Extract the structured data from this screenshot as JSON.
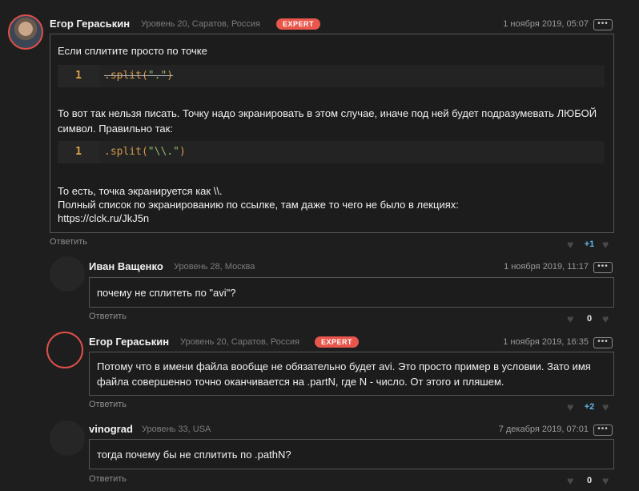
{
  "comments": [
    {
      "author": "Егор Гераськин",
      "meta": "Уровень 20, Саратов, Россия",
      "badge": "EXPERT",
      "date": "1 ноября 2019, 05:07",
      "text1": "Если сплитите просто по точке",
      "code1": {
        "line": "1",
        "prefix": ".split(",
        "str": "\".\"",
        "suffix": ")"
      },
      "text2": "То вот так нельзя писать. Точку надо экранировать в этом случае, иначе под ней будет подразумевать ЛЮБОЙ символ. Правильно так:",
      "code2": {
        "line": "1",
        "prefix": ".split(",
        "str": "\"\\\\.\"",
        "suffix": ")"
      },
      "text3a": "То есть, точка экранируется как \\\\.",
      "text3b": "Полный список по экранированию по ссылке, там даже то чего не было в лекциях:",
      "text3c": "https://clck.ru/JkJ5n",
      "reply": "Ответить",
      "votes": "+1"
    },
    {
      "author": "Иван Ващенко",
      "meta": "Уровень 28, Москва",
      "date": "1 ноября 2019, 11:17",
      "text": "почему не сплитеть по \"avi\"?",
      "reply": "Ответить",
      "votes": "0"
    },
    {
      "author": "Егор Гераськин",
      "meta": "Уровень 20, Саратов, Россия",
      "badge": "EXPERT",
      "date": "1 ноября 2019, 16:35",
      "text": "Потому что в имени файла вообще не обязательно будет avi. Это просто пример в условии. Зато имя файла совершенно точно оканчивается на .partN, где N - число. От этого и пляшем.",
      "reply": "Ответить",
      "votes": "+2"
    },
    {
      "author": "vinograd",
      "meta": "Уровень 33, USA",
      "date": "7 декабря 2019, 07:01",
      "text": "тогда почему бы не сплитить по .pathN?",
      "reply": "Ответить",
      "votes": "0"
    }
  ],
  "icons": {
    "more": "ellipsis-icon",
    "like": "heart-icon",
    "dislike": "heart-icon"
  },
  "colors": {
    "badge": "#e9564b",
    "plus": "#5fb3e8",
    "code_key": "#d39a4a",
    "code_str": "#8fb86b"
  }
}
